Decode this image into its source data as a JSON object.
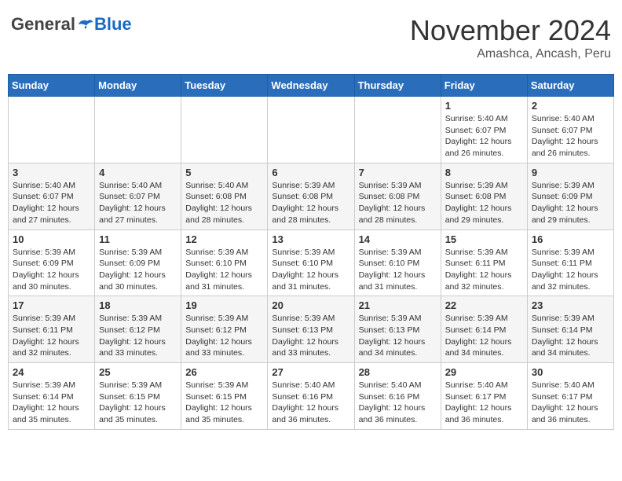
{
  "header": {
    "logo_general": "General",
    "logo_blue": "Blue",
    "month": "November 2024",
    "location": "Amashca, Ancash, Peru"
  },
  "days_of_week": [
    "Sunday",
    "Monday",
    "Tuesday",
    "Wednesday",
    "Thursday",
    "Friday",
    "Saturday"
  ],
  "weeks": [
    [
      {
        "day": "",
        "info": ""
      },
      {
        "day": "",
        "info": ""
      },
      {
        "day": "",
        "info": ""
      },
      {
        "day": "",
        "info": ""
      },
      {
        "day": "",
        "info": ""
      },
      {
        "day": "1",
        "info": "Sunrise: 5:40 AM\nSunset: 6:07 PM\nDaylight: 12 hours and 26 minutes."
      },
      {
        "day": "2",
        "info": "Sunrise: 5:40 AM\nSunset: 6:07 PM\nDaylight: 12 hours and 26 minutes."
      }
    ],
    [
      {
        "day": "3",
        "info": "Sunrise: 5:40 AM\nSunset: 6:07 PM\nDaylight: 12 hours and 27 minutes."
      },
      {
        "day": "4",
        "info": "Sunrise: 5:40 AM\nSunset: 6:07 PM\nDaylight: 12 hours and 27 minutes."
      },
      {
        "day": "5",
        "info": "Sunrise: 5:40 AM\nSunset: 6:08 PM\nDaylight: 12 hours and 28 minutes."
      },
      {
        "day": "6",
        "info": "Sunrise: 5:39 AM\nSunset: 6:08 PM\nDaylight: 12 hours and 28 minutes."
      },
      {
        "day": "7",
        "info": "Sunrise: 5:39 AM\nSunset: 6:08 PM\nDaylight: 12 hours and 28 minutes."
      },
      {
        "day": "8",
        "info": "Sunrise: 5:39 AM\nSunset: 6:08 PM\nDaylight: 12 hours and 29 minutes."
      },
      {
        "day": "9",
        "info": "Sunrise: 5:39 AM\nSunset: 6:09 PM\nDaylight: 12 hours and 29 minutes."
      }
    ],
    [
      {
        "day": "10",
        "info": "Sunrise: 5:39 AM\nSunset: 6:09 PM\nDaylight: 12 hours and 30 minutes."
      },
      {
        "day": "11",
        "info": "Sunrise: 5:39 AM\nSunset: 6:09 PM\nDaylight: 12 hours and 30 minutes."
      },
      {
        "day": "12",
        "info": "Sunrise: 5:39 AM\nSunset: 6:10 PM\nDaylight: 12 hours and 31 minutes."
      },
      {
        "day": "13",
        "info": "Sunrise: 5:39 AM\nSunset: 6:10 PM\nDaylight: 12 hours and 31 minutes."
      },
      {
        "day": "14",
        "info": "Sunrise: 5:39 AM\nSunset: 6:10 PM\nDaylight: 12 hours and 31 minutes."
      },
      {
        "day": "15",
        "info": "Sunrise: 5:39 AM\nSunset: 6:11 PM\nDaylight: 12 hours and 32 minutes."
      },
      {
        "day": "16",
        "info": "Sunrise: 5:39 AM\nSunset: 6:11 PM\nDaylight: 12 hours and 32 minutes."
      }
    ],
    [
      {
        "day": "17",
        "info": "Sunrise: 5:39 AM\nSunset: 6:11 PM\nDaylight: 12 hours and 32 minutes."
      },
      {
        "day": "18",
        "info": "Sunrise: 5:39 AM\nSunset: 6:12 PM\nDaylight: 12 hours and 33 minutes."
      },
      {
        "day": "19",
        "info": "Sunrise: 5:39 AM\nSunset: 6:12 PM\nDaylight: 12 hours and 33 minutes."
      },
      {
        "day": "20",
        "info": "Sunrise: 5:39 AM\nSunset: 6:13 PM\nDaylight: 12 hours and 33 minutes."
      },
      {
        "day": "21",
        "info": "Sunrise: 5:39 AM\nSunset: 6:13 PM\nDaylight: 12 hours and 34 minutes."
      },
      {
        "day": "22",
        "info": "Sunrise: 5:39 AM\nSunset: 6:14 PM\nDaylight: 12 hours and 34 minutes."
      },
      {
        "day": "23",
        "info": "Sunrise: 5:39 AM\nSunset: 6:14 PM\nDaylight: 12 hours and 34 minutes."
      }
    ],
    [
      {
        "day": "24",
        "info": "Sunrise: 5:39 AM\nSunset: 6:14 PM\nDaylight: 12 hours and 35 minutes."
      },
      {
        "day": "25",
        "info": "Sunrise: 5:39 AM\nSunset: 6:15 PM\nDaylight: 12 hours and 35 minutes."
      },
      {
        "day": "26",
        "info": "Sunrise: 5:39 AM\nSunset: 6:15 PM\nDaylight: 12 hours and 35 minutes."
      },
      {
        "day": "27",
        "info": "Sunrise: 5:40 AM\nSunset: 6:16 PM\nDaylight: 12 hours and 36 minutes."
      },
      {
        "day": "28",
        "info": "Sunrise: 5:40 AM\nSunset: 6:16 PM\nDaylight: 12 hours and 36 minutes."
      },
      {
        "day": "29",
        "info": "Sunrise: 5:40 AM\nSunset: 6:17 PM\nDaylight: 12 hours and 36 minutes."
      },
      {
        "day": "30",
        "info": "Sunrise: 5:40 AM\nSunset: 6:17 PM\nDaylight: 12 hours and 36 minutes."
      }
    ]
  ]
}
